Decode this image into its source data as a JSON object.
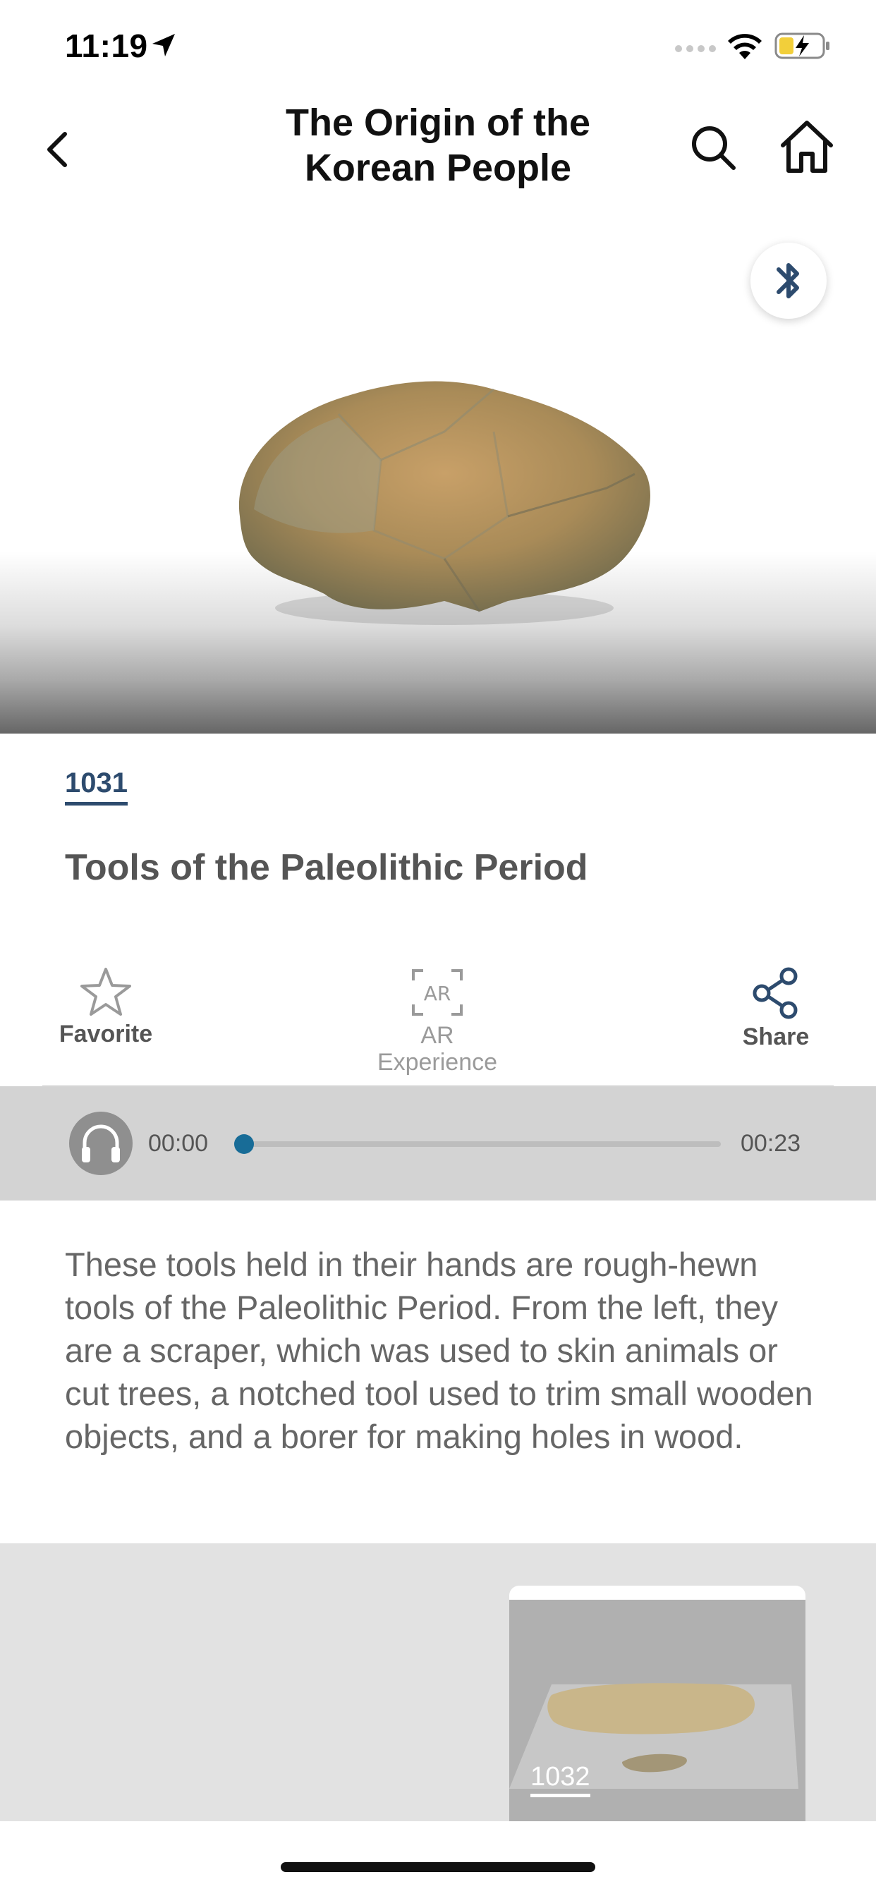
{
  "status_bar": {
    "time": "11:19"
  },
  "nav": {
    "title_line1": "The Origin of the",
    "title_line2": "Korean People"
  },
  "item": {
    "number": "1031",
    "title": "Tools of the Paleolithic Period"
  },
  "actions": {
    "favorite_label": "Favorite",
    "ar_label_line1": "AR",
    "ar_label_line2": "Experience",
    "share_label": "Share"
  },
  "audio": {
    "current_time": "00:00",
    "total_time": "00:23",
    "progress": 0
  },
  "description": "These tools held in their hands are rough-hewn tools of the Paleolithic Period. From the left, they are a scraper, which was used to skin animals or cut trees, a notched tool used to trim small wooden objects, and a borer for making holes in wood.",
  "related": {
    "items": [
      {
        "number": "1032"
      }
    ]
  },
  "colors": {
    "accent": "#2d4b6e",
    "audio_knob": "#186c97",
    "audio_bar_bg": "#d3d3d3"
  }
}
